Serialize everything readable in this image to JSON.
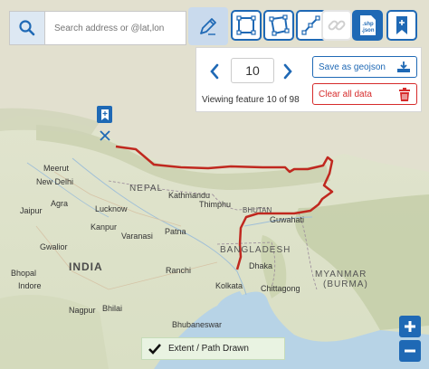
{
  "search": {
    "placeholder": "Search address or @lat,lon"
  },
  "toolbar": {
    "items": [
      {
        "name": "draw-tool",
        "icon": "pencil-icon"
      },
      {
        "name": "rectangle-tool",
        "icon": "rectangle-icon"
      },
      {
        "name": "polygon-tool",
        "icon": "polygon-icon"
      },
      {
        "name": "line-tool",
        "icon": "polyline-icon"
      },
      {
        "name": "link-tool",
        "icon": "link-icon",
        "disabled": true
      },
      {
        "name": "shapefile-tool",
        "icon": "shp-json-icon",
        "label_top": ".shp",
        "label_bottom": ".json"
      },
      {
        "name": "bookmark-tool",
        "icon": "bookmark-icon"
      }
    ]
  },
  "feature_nav": {
    "current": "10",
    "status": "Viewing feature 10 of 98"
  },
  "actions": {
    "save_label": "Save as geojson",
    "clear_label": "Clear all data"
  },
  "status_bar": {
    "label": "Extent / Path Drawn"
  },
  "map_labels": {
    "meerut": "Meerut",
    "new_delhi": "New Delhi",
    "jaipur": "Jaipur",
    "agra": "Agra",
    "lucknow": "Lucknow",
    "kanpur": "Kanpur",
    "varanasi": "Varanasi",
    "patna": "Patna",
    "gwalior": "Gwalior",
    "bhopal": "Bhopal",
    "india": "INDIA",
    "indore": "Indore",
    "ranchi": "Ranchi",
    "kolkata": "Kolkata",
    "nagpur": "Nagpur",
    "bhilai": "Bhilai",
    "bhubaneswar": "Bhubaneswar",
    "nepal": "NEPAL",
    "kathmandu": "Kathmandu",
    "thimphu": "Thimphu",
    "bhutan": "BHUTAN",
    "guwahati": "Guwahati",
    "bangladesh": "BANGLADESH",
    "dhaka": "Dhaka",
    "chittagong": "Chittagong",
    "myanmar": "MYANMAR",
    "burma": "(BURMA)"
  },
  "colors": {
    "accent": "#1f69b5",
    "danger": "#d62b2b",
    "path": "#c0281f",
    "status_bg": "#e9f3e2"
  }
}
